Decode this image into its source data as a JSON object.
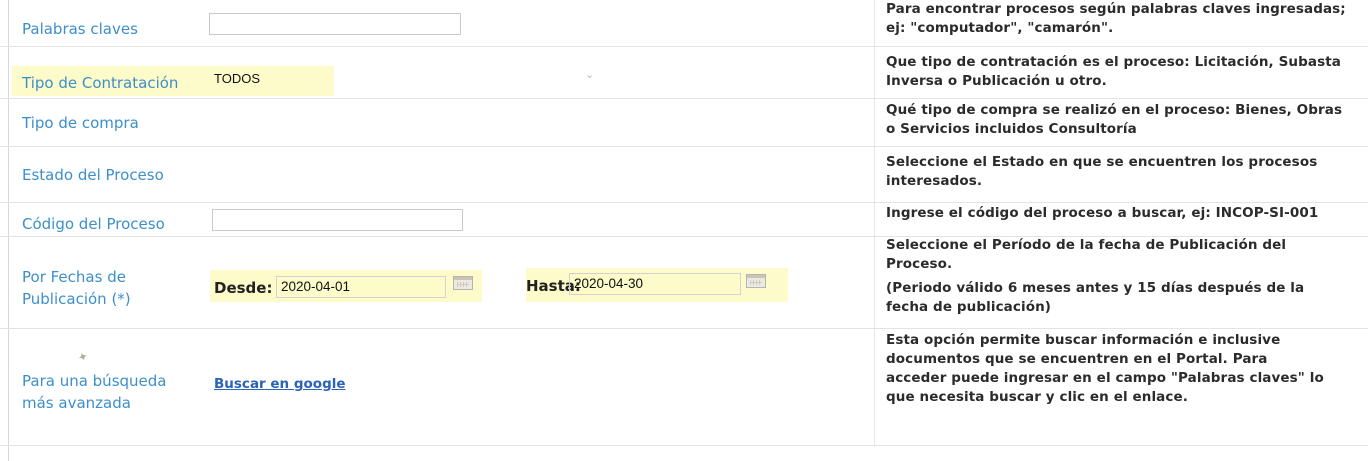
{
  "rows": {
    "palabras": {
      "label": "Palabras claves",
      "input_value": "",
      "description": "Para encontrar procesos según palabras claves ingresadas; ej: \"computador\", \"camarón\"."
    },
    "tipo_contratacion": {
      "label": "Tipo de Contratación",
      "selected": "TODOS",
      "description": "Que tipo de contratación es el proceso: Licitación, Subasta Inversa o Publicación u otro."
    },
    "tipo_compra": {
      "label": "Tipo de compra",
      "description": "Qué tipo de compra se realizó en el proceso: Bienes, Obras o Servicios incluidos Consultoría"
    },
    "estado": {
      "label": "Estado del Proceso",
      "description": "Seleccione el Estado en que se encuentren los procesos interesados."
    },
    "codigo": {
      "label": "Código del Proceso",
      "input_value": "",
      "description": "Ingrese el código del proceso a buscar, ej: INCOP-SI-001"
    },
    "fechas": {
      "label_line1": "Por Fechas de",
      "label_line2": "Publicación (*)",
      "desde_label": "Desde:",
      "desde_value": "2020-04-01",
      "hasta_label": "Hasta:",
      "hasta_value": "2020-04-30",
      "description_line1": "Seleccione el Período de la fecha de Publicación del Proceso.",
      "description_line2": "(Periodo válido 6 meses antes y 15 días después de la fecha de publicación)"
    },
    "avanzada": {
      "label_line1": "Para una búsqueda",
      "label_line2": "más avanzada",
      "link": "Buscar en google",
      "description": "Esta opción permite buscar información e inclusive documentos que se encuentren en el Portal. Para acceder puede ingresar en el campo \"Palabras claves\" lo que necesita buscar y clic en el enlace."
    }
  },
  "icons": {
    "calendar": "calendar-icon",
    "chevron": "chevron-down-icon"
  },
  "colors": {
    "label": "#3d8fcb",
    "highlight": "#fdfbc9",
    "link": "#2a63b8"
  }
}
